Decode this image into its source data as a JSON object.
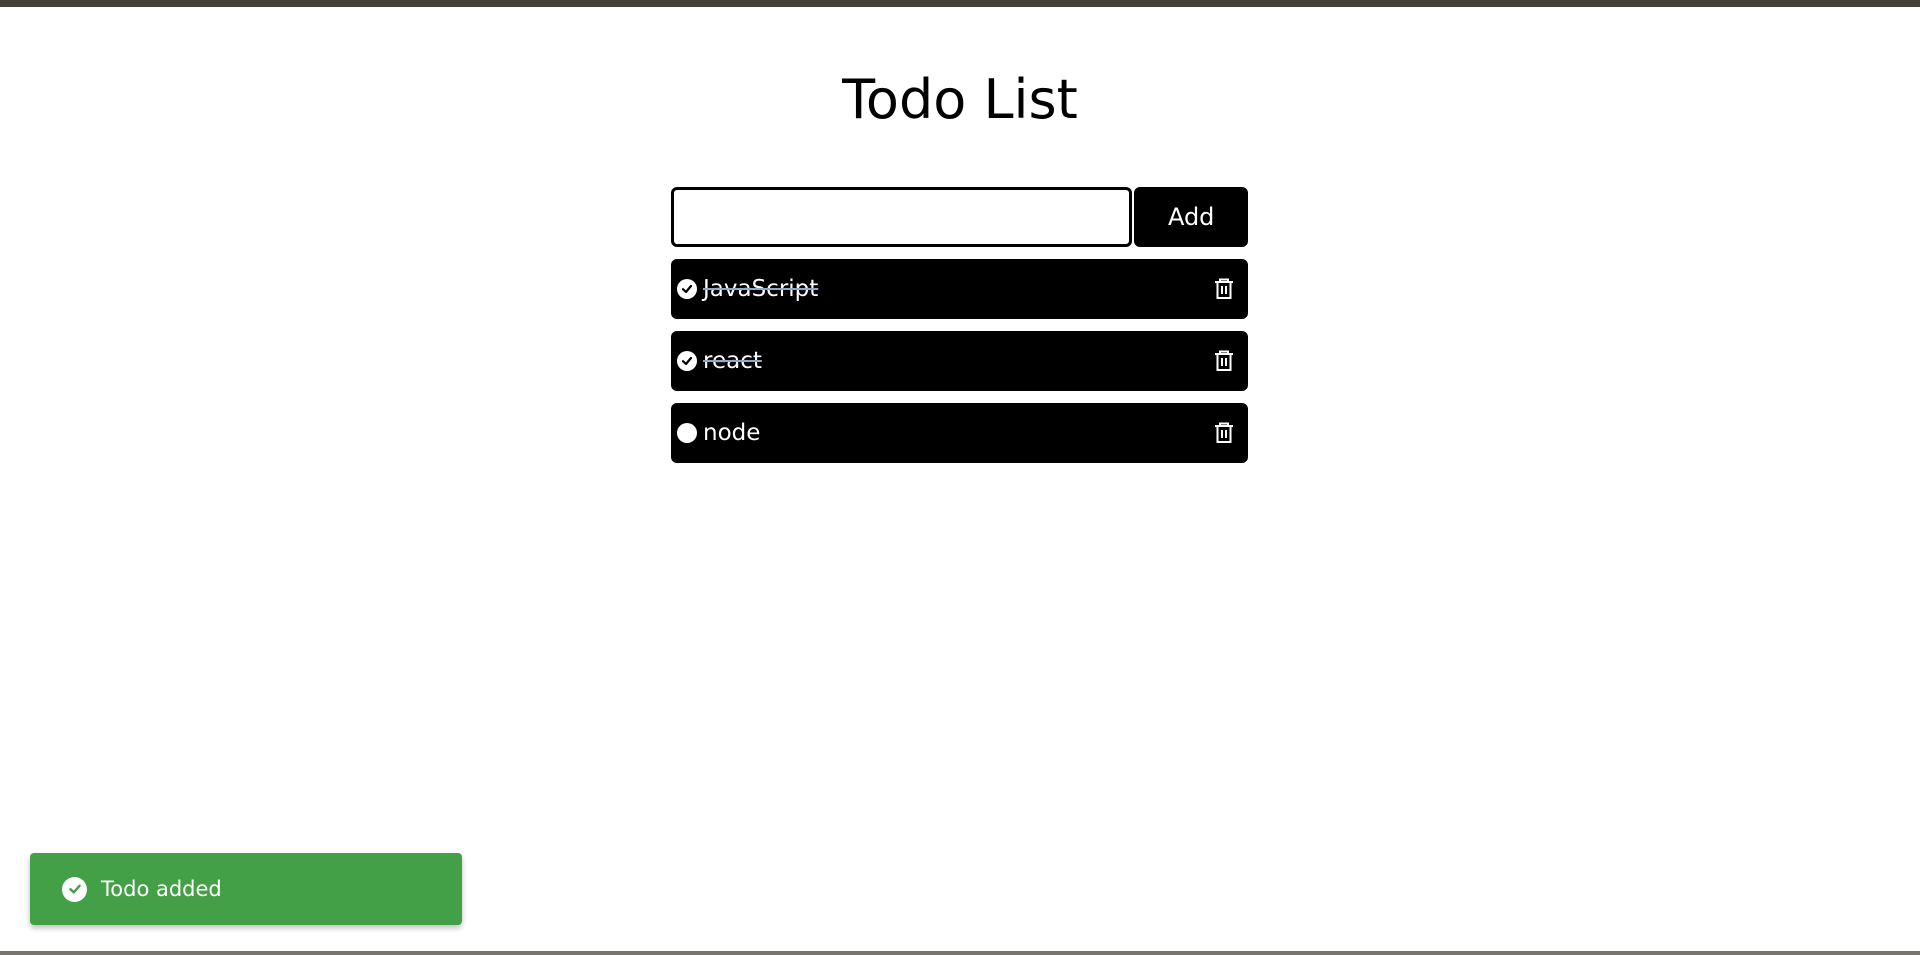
{
  "page": {
    "title": "Todo List"
  },
  "form": {
    "input_value": "",
    "input_placeholder": "",
    "add_label": "Add"
  },
  "todos": [
    {
      "text": "JavaScript",
      "completed": true
    },
    {
      "text": "react",
      "completed": true
    },
    {
      "text": "node",
      "completed": false
    }
  ],
  "toast": {
    "message": "Todo added",
    "color": "#43a047"
  },
  "icons": {
    "completed": "check-circle-icon",
    "incomplete": "circle-icon",
    "delete": "trash-icon",
    "toast": "check-circle-icon"
  }
}
